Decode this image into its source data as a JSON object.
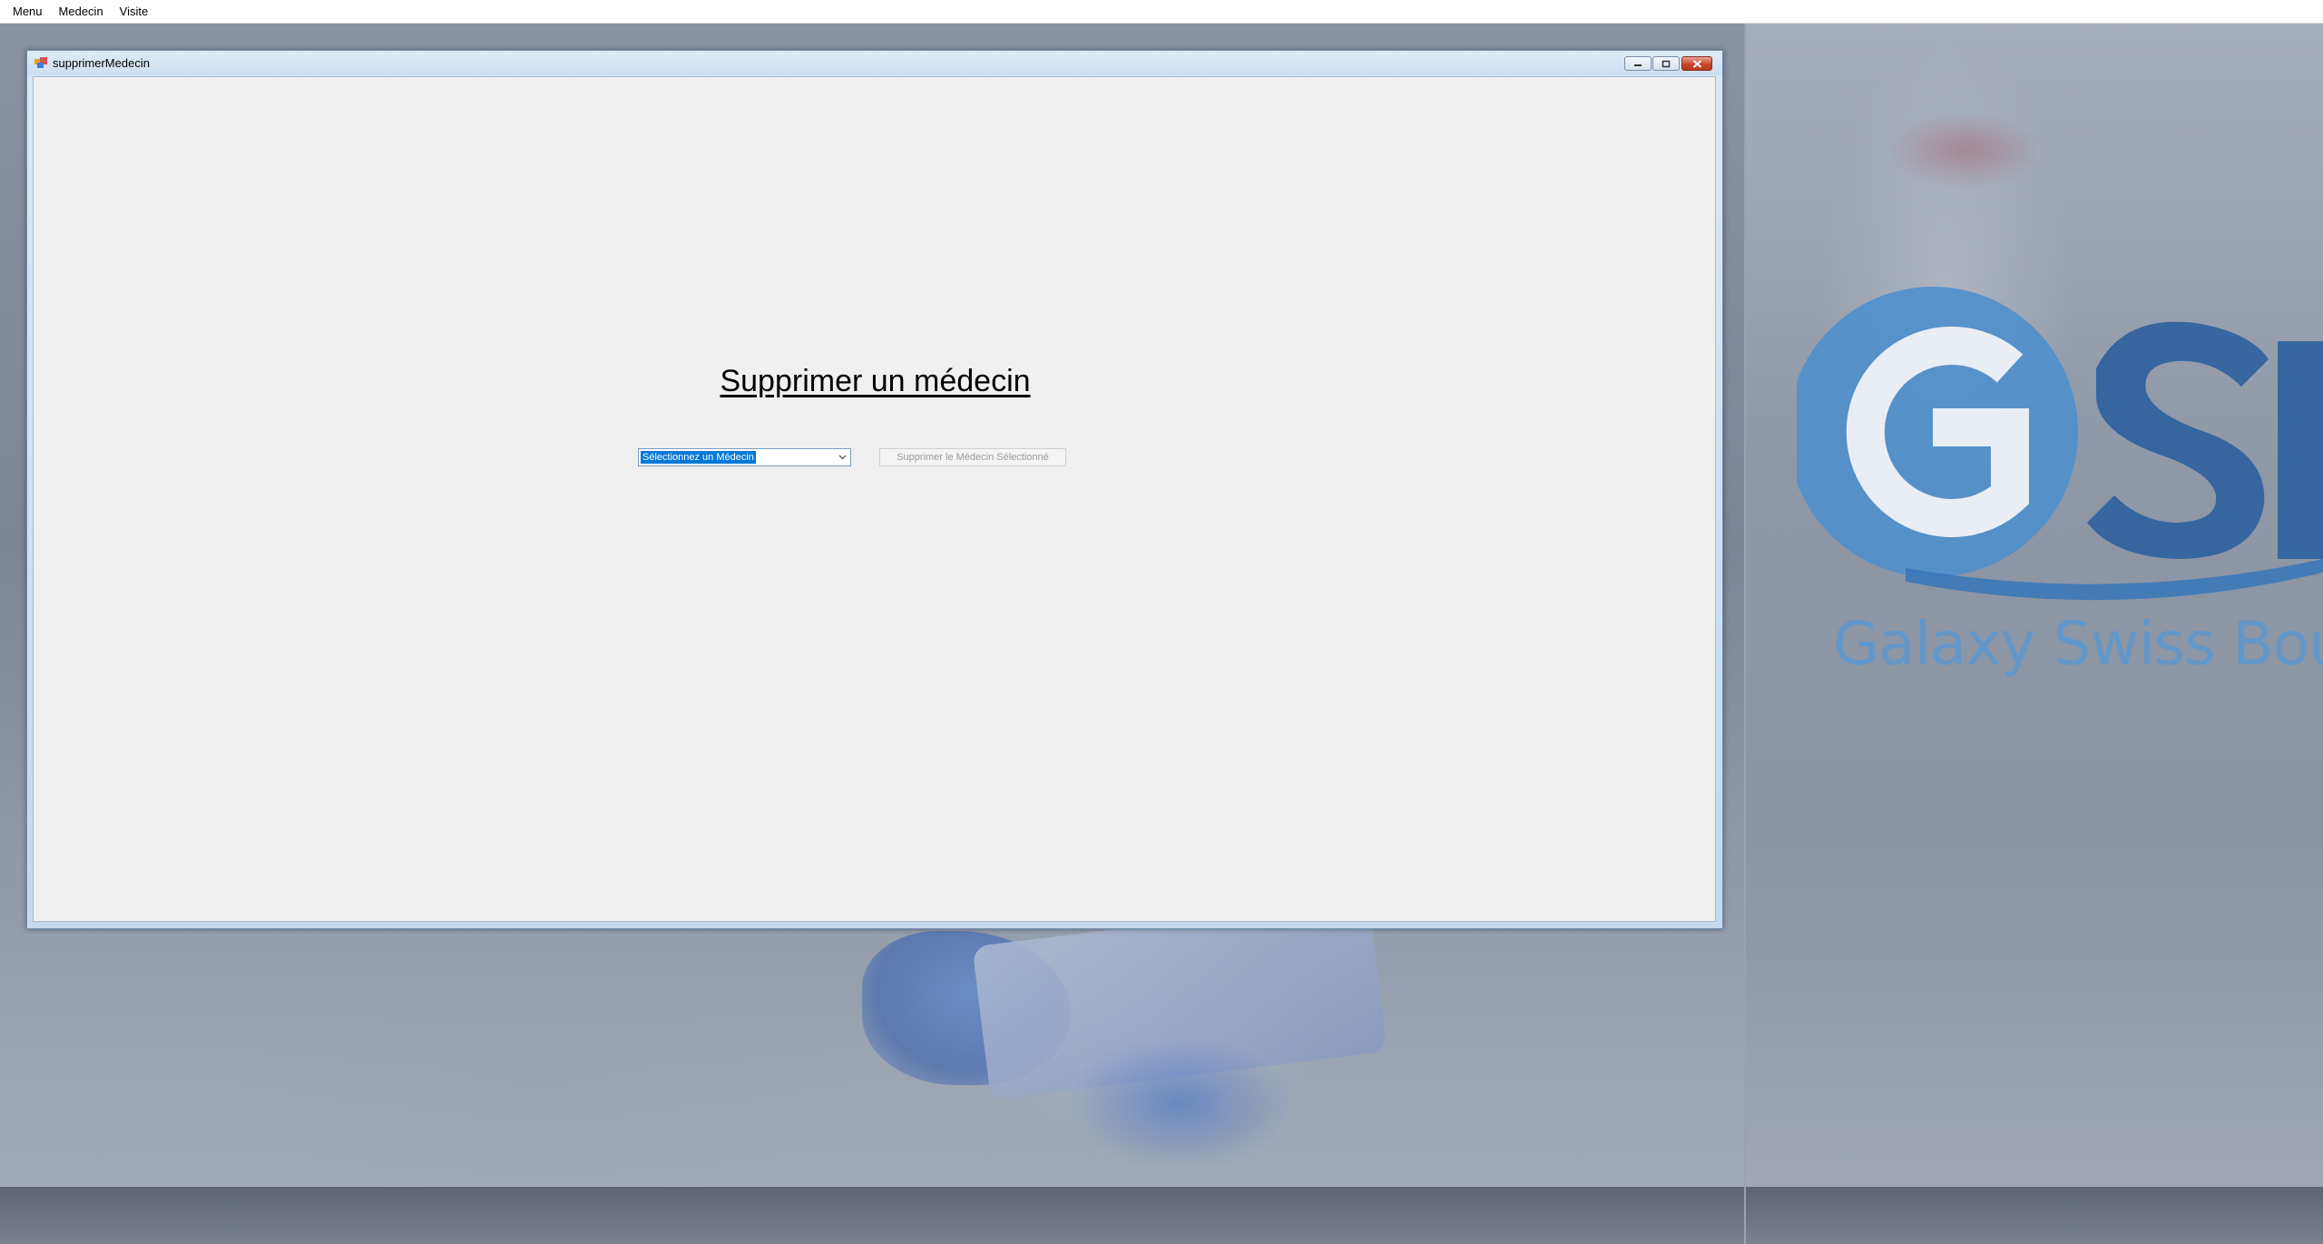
{
  "menubar": {
    "items": [
      "Menu",
      "Medecin",
      "Visite"
    ]
  },
  "window": {
    "title": "supprimerMedecin",
    "icon": "app-icon"
  },
  "form": {
    "heading": "Supprimer un médecin",
    "combo_value": "Sélectionnez un Médecin",
    "delete_button_label": "Supprimer le Médecin Sélectionné",
    "delete_button_enabled": false
  },
  "background": {
    "logo_letters": "GSB",
    "logo_text": "Galaxy Swiss Bourdin"
  },
  "colors": {
    "logo_blue": "#5b98d0",
    "logo_dark_blue": "#2c5f9e",
    "selection": "#0078d7",
    "client_bg": "#f0f0f0"
  }
}
